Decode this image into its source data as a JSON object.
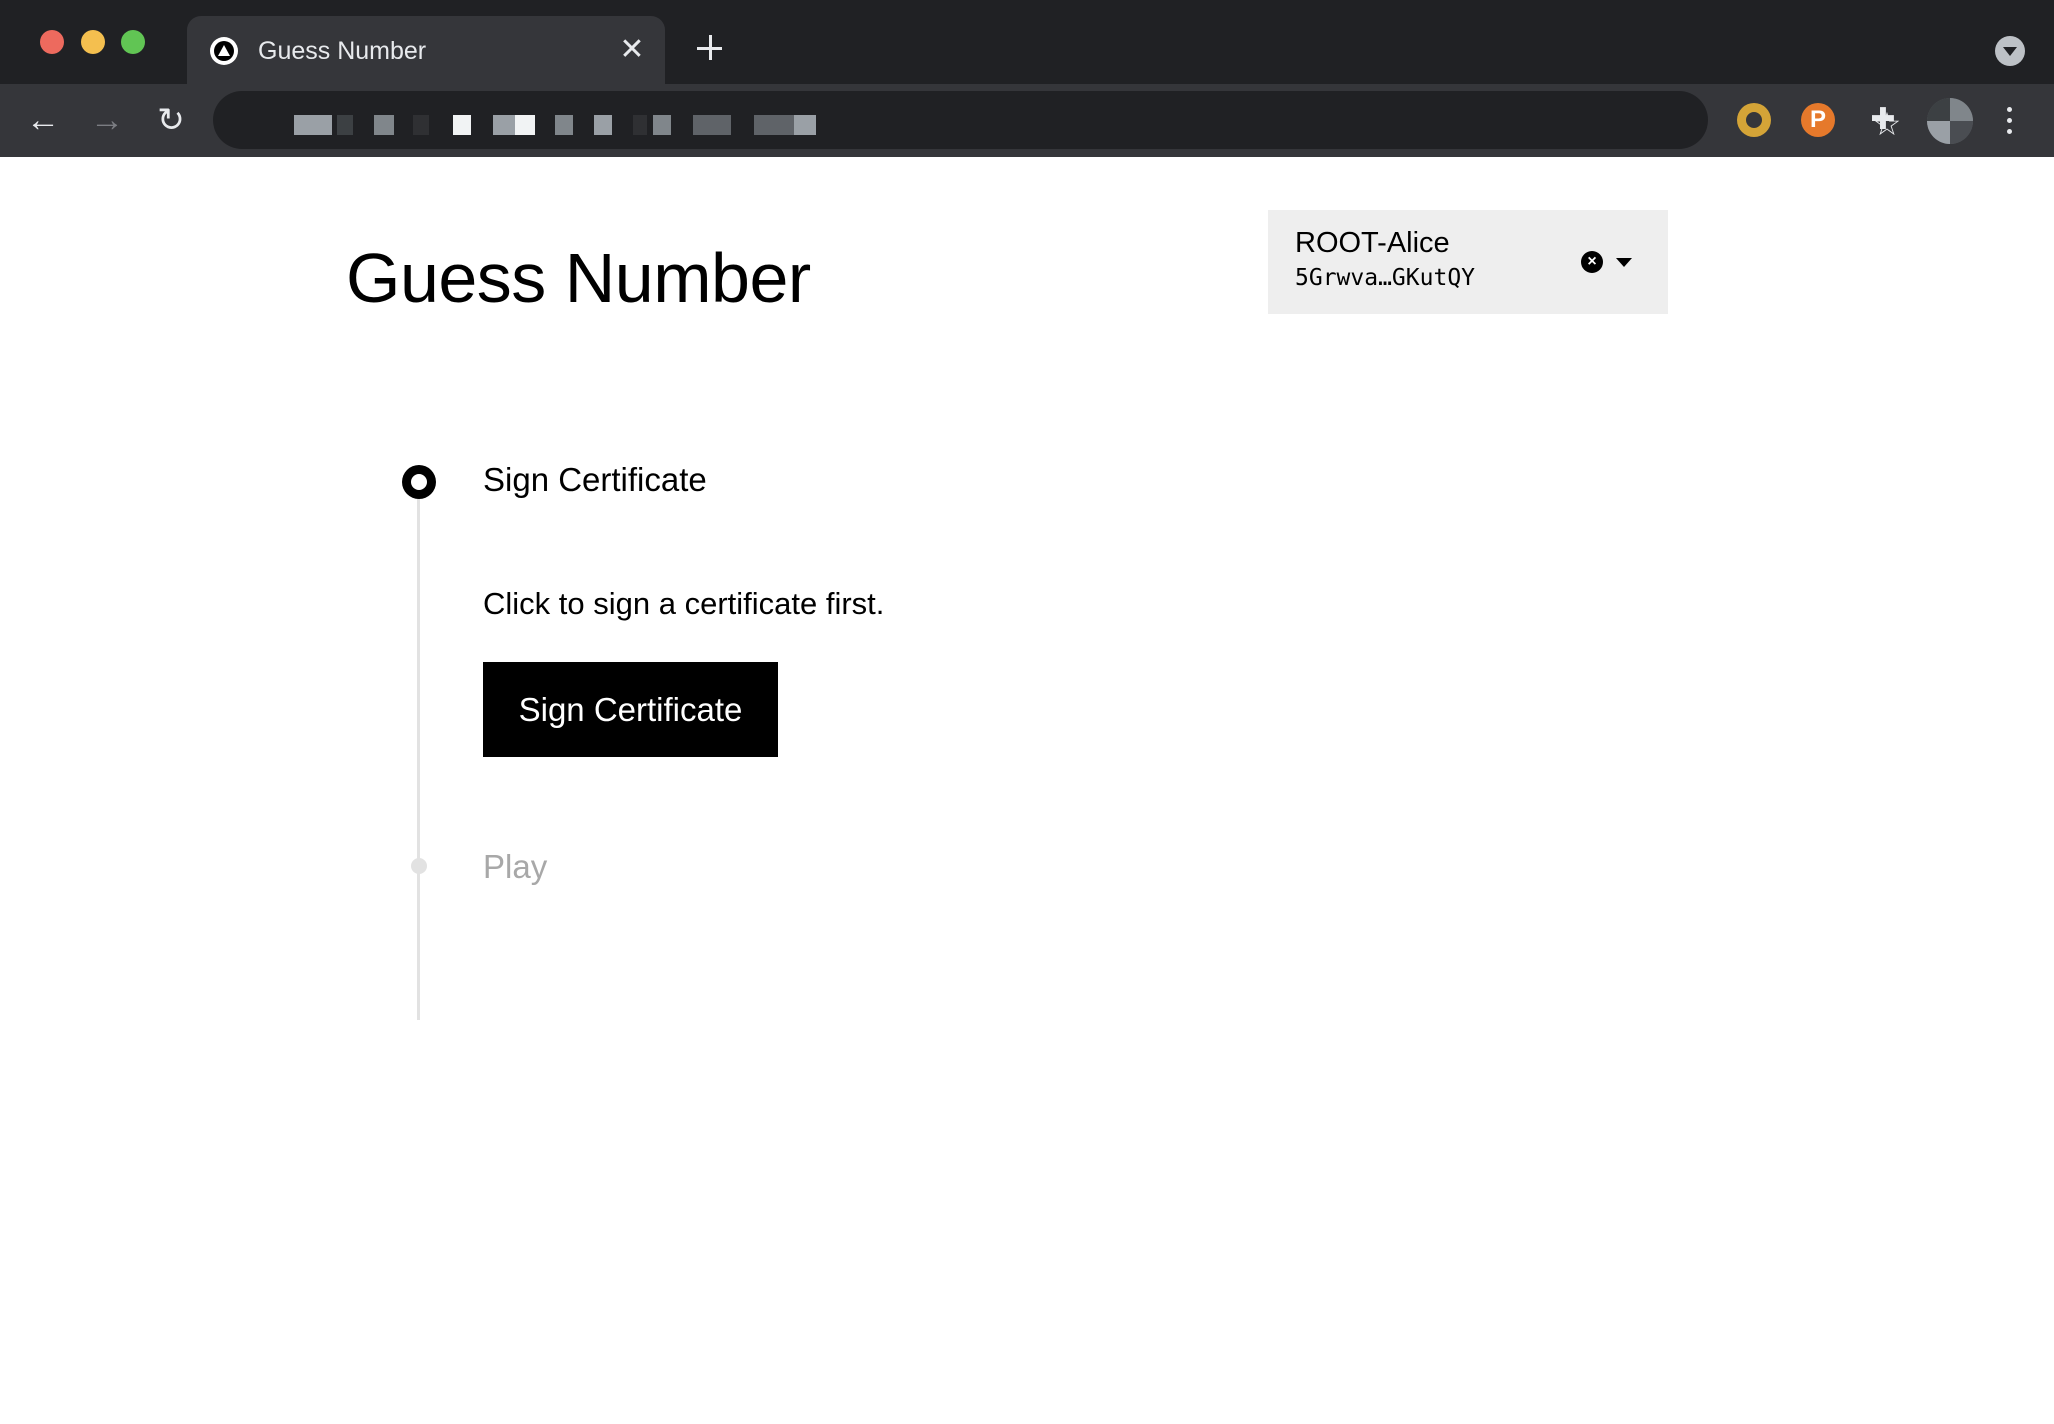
{
  "browser": {
    "tab_title": "Guess Number",
    "tab_close": "✕",
    "back": "←",
    "forward": "→",
    "reload": "↻",
    "star": "☆",
    "extension_p": "P",
    "extension_puzzle": "✚"
  },
  "header": {
    "title": "Guess Number"
  },
  "account": {
    "name": "ROOT-Alice",
    "address": "5Grwva…GKutQY",
    "clear_glyph": "×"
  },
  "steps": [
    {
      "title": "Sign Certificate",
      "description": "Click to sign a certificate first.",
      "button_label": "Sign Certificate",
      "state": "active"
    },
    {
      "title": "Play",
      "state": "inactive"
    }
  ],
  "colors": {
    "accent": "#000000",
    "inactive": "#a8a8a8",
    "account_bg": "#eeeeee"
  }
}
